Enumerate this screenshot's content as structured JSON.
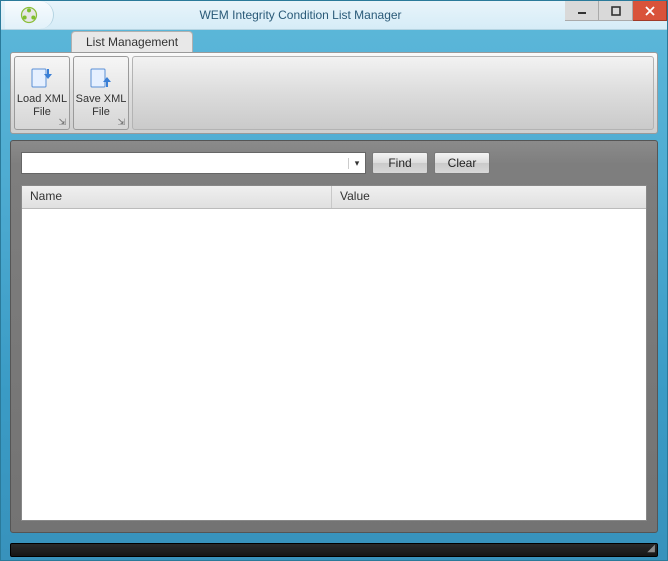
{
  "window": {
    "title": "WEM Integrity Condition List Manager"
  },
  "ribbon": {
    "tab_label": "List Management",
    "buttons": {
      "load": "Load XML\nFile",
      "save": "Save XML\nFile"
    }
  },
  "search": {
    "value": "",
    "find_label": "Find",
    "clear_label": "Clear"
  },
  "grid": {
    "columns": {
      "name": "Name",
      "value": "Value"
    },
    "rows": []
  }
}
